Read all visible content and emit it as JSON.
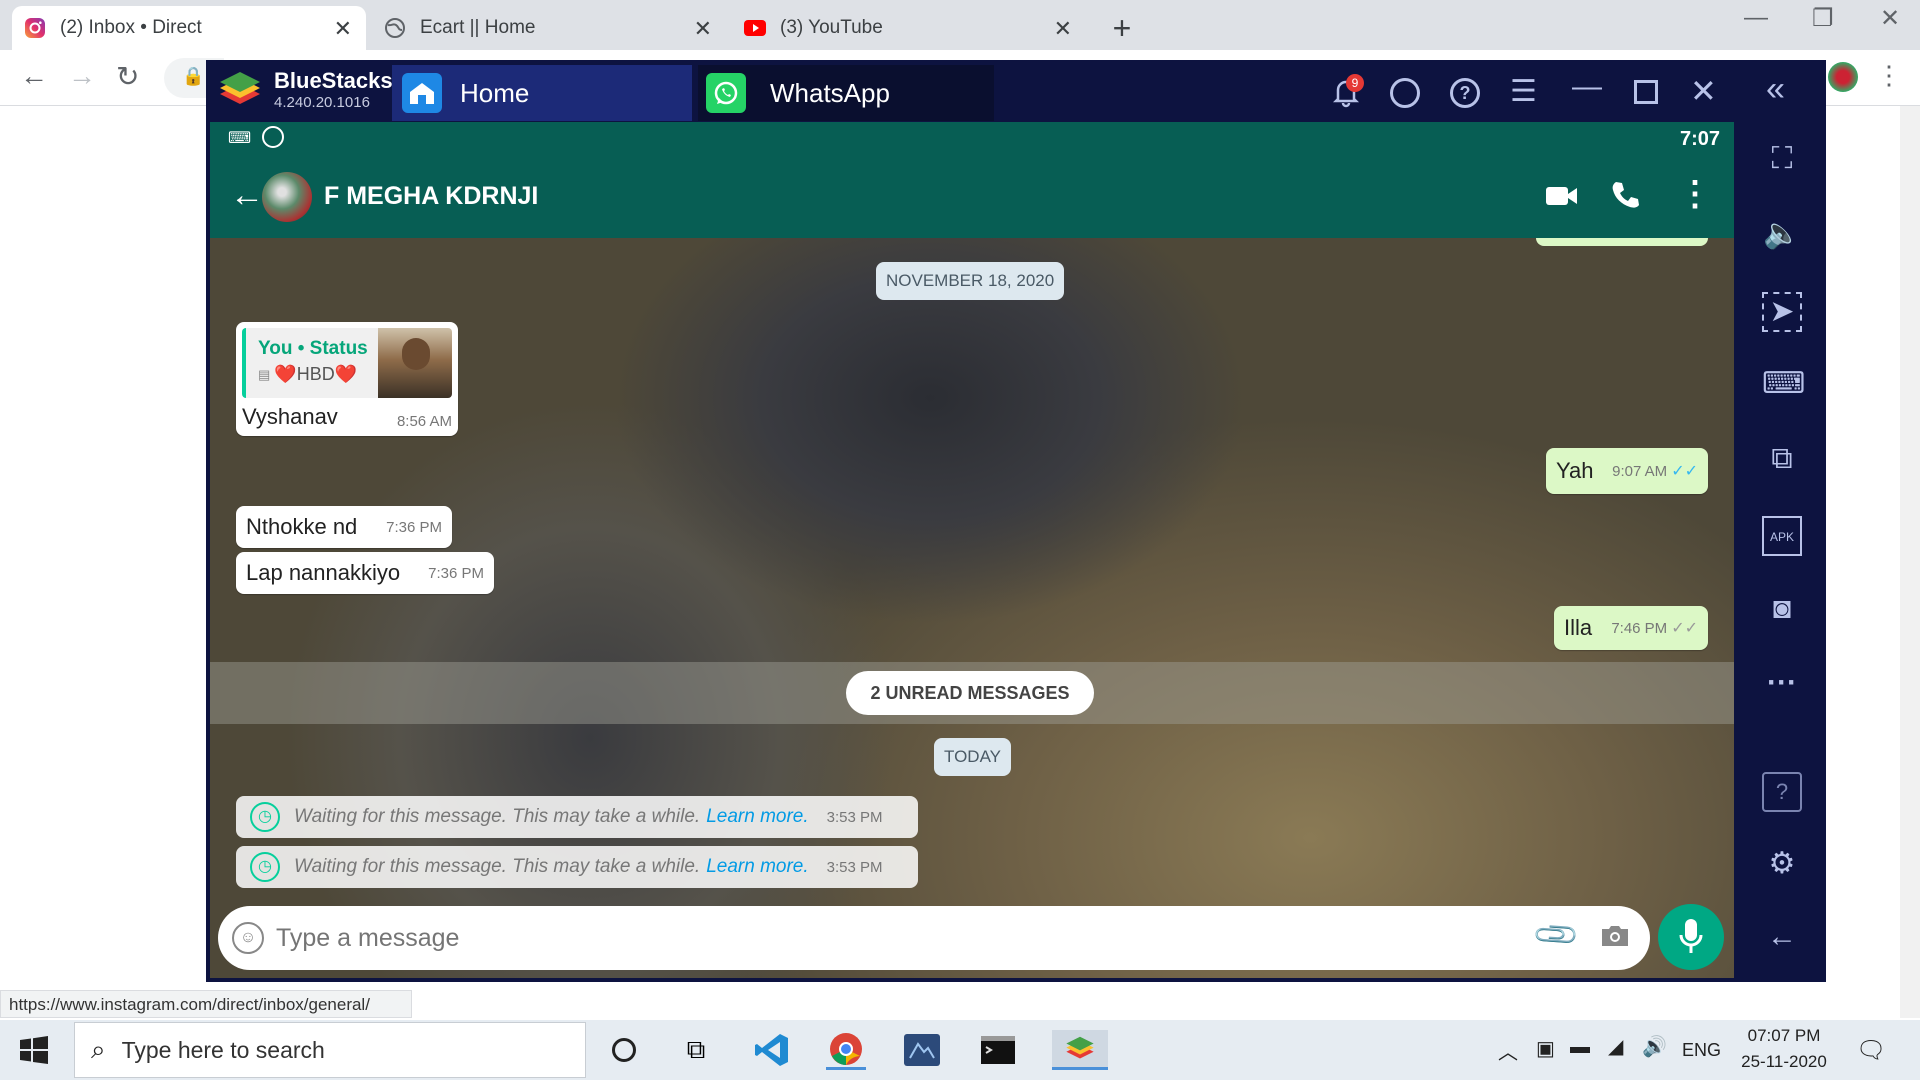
{
  "browser": {
    "tabs": [
      {
        "title": "(2) Inbox • Direct",
        "icon": "instagram-icon",
        "active": true
      },
      {
        "title": "Ecart || Home",
        "icon": "globe-icon",
        "active": false
      },
      {
        "title": "(3) YouTube",
        "icon": "youtube-icon",
        "active": false
      }
    ],
    "status_url": "https://www.instagram.com/direct/inbox/general/"
  },
  "bluestacks": {
    "brand": "BlueStacks",
    "version": "4.240.20.1016",
    "tabs": [
      {
        "label": "Home",
        "icon": "home-icon"
      },
      {
        "label": "WhatsApp",
        "icon": "whatsapp-icon"
      }
    ],
    "notification_count": "9"
  },
  "android": {
    "clock": "7:07"
  },
  "chat": {
    "contact": "F MEGHA KDRNJI",
    "date_pill": "NOVEMBER 18, 2020",
    "reply": {
      "author": "You • Status",
      "quote": "❤️HBD❤️",
      "text": "Vyshanav",
      "time": "8:56 AM"
    },
    "messages_in": [
      {
        "text": "Nthokke nd",
        "time": "7:36 PM"
      },
      {
        "text": "Lap nannakkiyo",
        "time": "7:36 PM"
      }
    ],
    "messages_out": [
      {
        "text": "Yah",
        "time": "9:07 AM",
        "status": "read"
      },
      {
        "text": "Illa",
        "time": "7:46 PM",
        "status": "delivered"
      }
    ],
    "unread_banner": "2 UNREAD MESSAGES",
    "today_pill": "TODAY",
    "waiting": [
      {
        "text": "Waiting for this message. This may take a while.",
        "link": "Learn more.",
        "time": "3:53 PM"
      },
      {
        "text": "Waiting for this message. This may take a while.",
        "link": "Learn more.",
        "time": "3:53 PM"
      }
    ],
    "composer_placeholder": "Type a message"
  },
  "taskbar": {
    "search_placeholder": "Type here to search",
    "lang": "ENG",
    "time": "07:07 PM",
    "date": "25-11-2020"
  },
  "colors": {
    "wa_green": "#075e54",
    "wa_accent": "#00a884",
    "bs_navy": "#0d1340"
  }
}
